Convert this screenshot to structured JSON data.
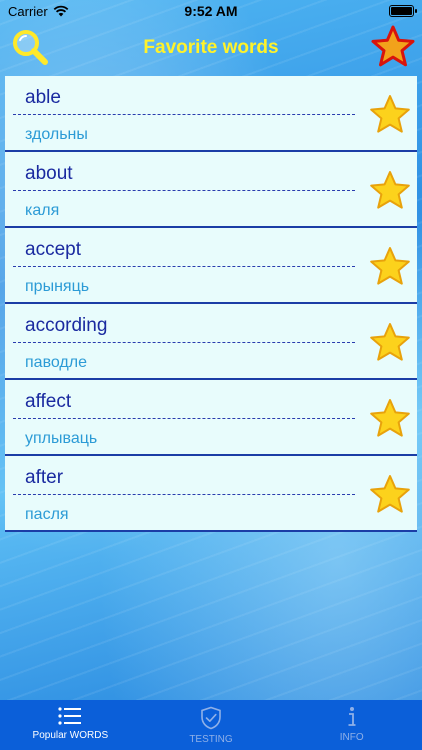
{
  "status_bar": {
    "carrier": "Carrier",
    "time": "9:52 AM"
  },
  "header": {
    "title": "Favorite words"
  },
  "words": [
    {
      "word": "able",
      "translation": "здольны"
    },
    {
      "word": "about",
      "translation": "каля"
    },
    {
      "word": "accept",
      "translation": "прыняць"
    },
    {
      "word": "according",
      "translation": "паводле"
    },
    {
      "word": "affect",
      "translation": "уплываць"
    },
    {
      "word": "after",
      "translation": "пасля"
    }
  ],
  "tabs": [
    {
      "label": "Popular WORDS",
      "icon": "list-icon",
      "active": true
    },
    {
      "label": "TESTING",
      "icon": "shield-check-icon",
      "active": false
    },
    {
      "label": "INFO",
      "icon": "info-icon",
      "active": false
    }
  ],
  "colors": {
    "title": "#fff22a",
    "word": "#1a2aa0",
    "translation": "#2c9bd6",
    "tabbar": "#0b5fd9",
    "star": "#fcd21c"
  }
}
